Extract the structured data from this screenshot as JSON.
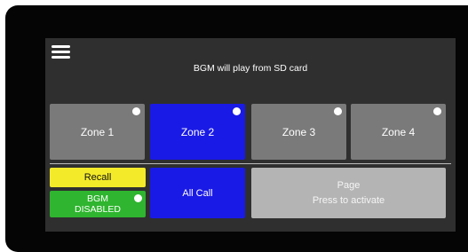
{
  "status_message": "BGM will play from SD card",
  "zones": [
    {
      "label": "Zone 1",
      "selected": false
    },
    {
      "label": "Zone 2",
      "selected": true
    },
    {
      "label": "Zone 3",
      "selected": false
    },
    {
      "label": "Zone 4",
      "selected": false
    }
  ],
  "controls": {
    "recall_label": "Recall",
    "bgm_line1": "BGM",
    "bgm_line2": "DISABLED",
    "all_call_label": "All Call",
    "page_title": "Page",
    "page_hint": "Press to activate"
  },
  "colors": {
    "zone_unselected": "#7a7a7a",
    "zone_selected": "#1a1ae6",
    "recall": "#f3ea2a",
    "bgm": "#2fb52f",
    "all_call": "#1a1ae6",
    "page": "#b4b4b4",
    "panel": "#2f2f2f"
  },
  "icons": {
    "menu": "hamburger-menu-icon",
    "indicator": "indicator-dot-icon"
  }
}
